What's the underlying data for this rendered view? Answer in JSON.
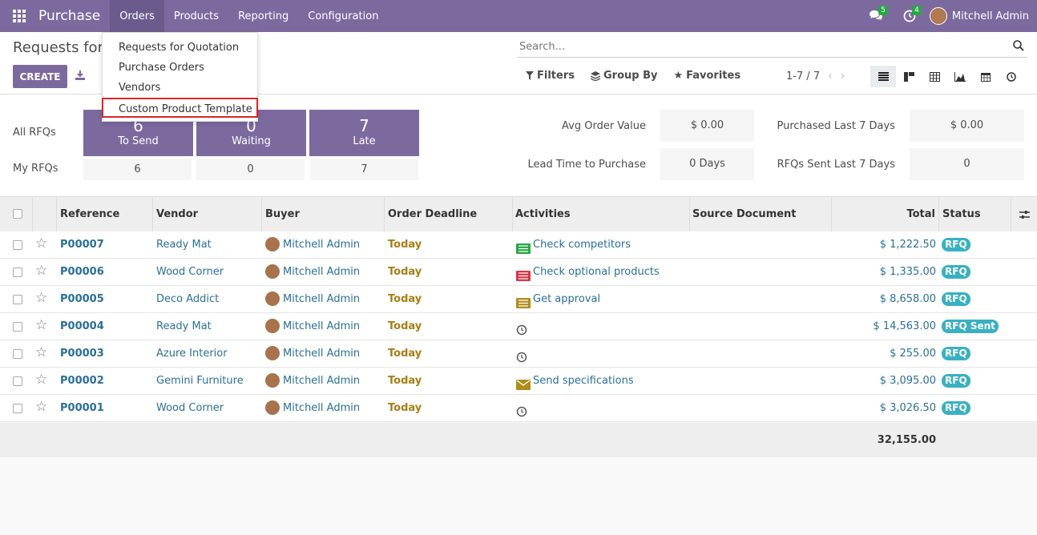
{
  "topbar": {
    "brand": "Purchase",
    "menu": [
      "Orders",
      "Products",
      "Reporting",
      "Configuration"
    ],
    "messages_count": "5",
    "activities_count": "4",
    "user_name": "Mitchell Admin"
  },
  "control": {
    "title": "Requests for Quotation",
    "create_label": "CREATE",
    "search_placeholder": "Search...",
    "filters_label": "Filters",
    "groupby_label": "Group By",
    "favorites_label": "Favorites",
    "pager": "1-7 / 7"
  },
  "dropdown": {
    "items": [
      "Requests for Quotation",
      "Purchase Orders",
      "Vendors",
      "Custom Product Template"
    ]
  },
  "dashboard": {
    "all_rfqs_label": "All RFQs",
    "my_rfqs_label": "My RFQs",
    "tiles": [
      {
        "value": "6",
        "label": "To Send",
        "mine": "6"
      },
      {
        "value": "0",
        "label": "Waiting",
        "mine": "0"
      },
      {
        "value": "7",
        "label": "Late",
        "mine": "7"
      }
    ],
    "stats": [
      {
        "label": "Avg Order Value",
        "value": "$ 0.00"
      },
      {
        "label": "Purchased Last 7 Days",
        "value": "$ 0.00"
      },
      {
        "label": "Lead Time to Purchase",
        "value": "0 Days"
      },
      {
        "label": "RFQs Sent Last 7 Days",
        "value": "0"
      }
    ]
  },
  "table": {
    "headers": [
      "Reference",
      "Vendor",
      "Buyer",
      "Order Deadline",
      "Activities",
      "Source Document",
      "Total",
      "Status"
    ],
    "rows": [
      {
        "ref": "P00007",
        "vendor": "Ready Mat",
        "buyer": "Mitchell Admin",
        "deadline": "Today",
        "activity": "Check competitors",
        "activity_icon": "list-green",
        "total": "$ 1,222.50",
        "status": "RFQ"
      },
      {
        "ref": "P00006",
        "vendor": "Wood Corner",
        "buyer": "Mitchell Admin",
        "deadline": "Today",
        "activity": "Check optional products",
        "activity_icon": "list-red",
        "total": "$ 1,335.00",
        "status": "RFQ"
      },
      {
        "ref": "P00005",
        "vendor": "Deco Addict",
        "buyer": "Mitchell Admin",
        "deadline": "Today",
        "activity": "Get approval",
        "activity_icon": "list-amber",
        "total": "$ 8,658.00",
        "status": "RFQ"
      },
      {
        "ref": "P00004",
        "vendor": "Ready Mat",
        "buyer": "Mitchell Admin",
        "deadline": "Today",
        "activity": "",
        "activity_icon": "clock",
        "total": "$ 14,563.00",
        "status": "RFQ Sent"
      },
      {
        "ref": "P00003",
        "vendor": "Azure Interior",
        "buyer": "Mitchell Admin",
        "deadline": "Today",
        "activity": "",
        "activity_icon": "clock",
        "total": "$ 255.00",
        "status": "RFQ"
      },
      {
        "ref": "P00002",
        "vendor": "Gemini Furniture",
        "buyer": "Mitchell Admin",
        "deadline": "Today",
        "activity": "Send specifications",
        "activity_icon": "envelope-amber",
        "total": "$ 3,095.00",
        "status": "RFQ"
      },
      {
        "ref": "P00001",
        "vendor": "Wood Corner",
        "buyer": "Mitchell Admin",
        "deadline": "Today",
        "activity": "",
        "activity_icon": "clock",
        "total": "$ 3,026.50",
        "status": "RFQ"
      }
    ],
    "grand_total": "32,155.00"
  },
  "colors": {
    "brand": "#7c6a9f",
    "link": "#2a6f99",
    "deadline": "#a87d16",
    "status_badge": "#3ab0c3",
    "highlight_border": "#d9262b"
  }
}
